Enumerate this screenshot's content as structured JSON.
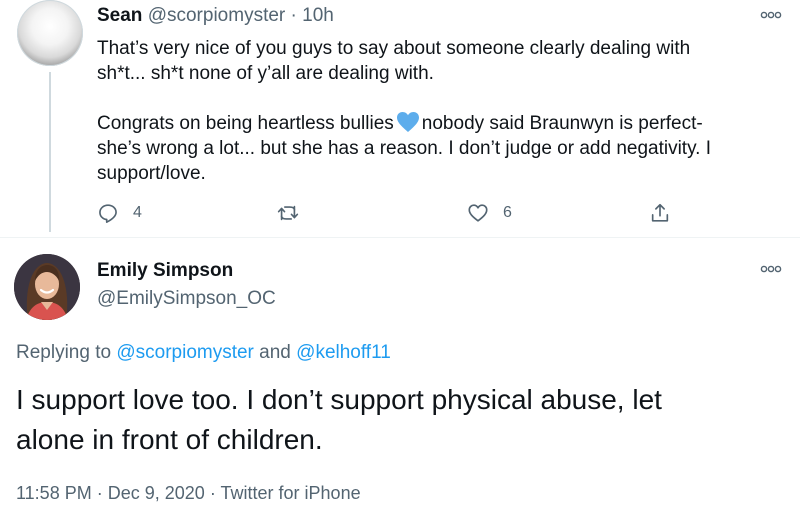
{
  "tweet1": {
    "name": "Sean",
    "handle": "@scorpiomyster",
    "separator": "·",
    "time": "10h",
    "body_line1": "That’s very nice of you guys to say about someone clearly dealing with",
    "body_line2": "sh*t... sh*t none of y’all are dealing with.",
    "body_line3a": "Congrats on being heartless bullies",
    "emoji": "blue-heart",
    "body_line3b": "nobody said Braunwyn is perfect-",
    "body_line4": "she’s wrong a lot... but she has a reason. I don’t judge or add negativity. I",
    "body_line5": "support/love.",
    "reply_count": "4",
    "like_count": "6",
    "icons": [
      "more-icon",
      "reply-icon",
      "retweet-icon",
      "like-icon",
      "share-icon"
    ]
  },
  "tweet2": {
    "name": "Emily Simpson",
    "handle": "@EmilySimpson_OC",
    "replying_prefix": "Replying to",
    "mention1": "@scorpiomyster",
    "replying_and": "and",
    "mention2": "@kelhoff11",
    "body_line1": "I support love too. I don’t support physical abuse, let",
    "body_line2": "alone in front of children.",
    "meta_time": "11:58 PM",
    "meta_sep1": "·",
    "meta_date": "Dec 9, 2020",
    "meta_sep2": "·",
    "meta_source": "Twitter for iPhone"
  },
  "colors": {
    "text": "#0f1419",
    "secondary": "#536471",
    "link": "#1d9bf0",
    "divider": "#eff3f4",
    "thread_line": "#cfd9de"
  }
}
